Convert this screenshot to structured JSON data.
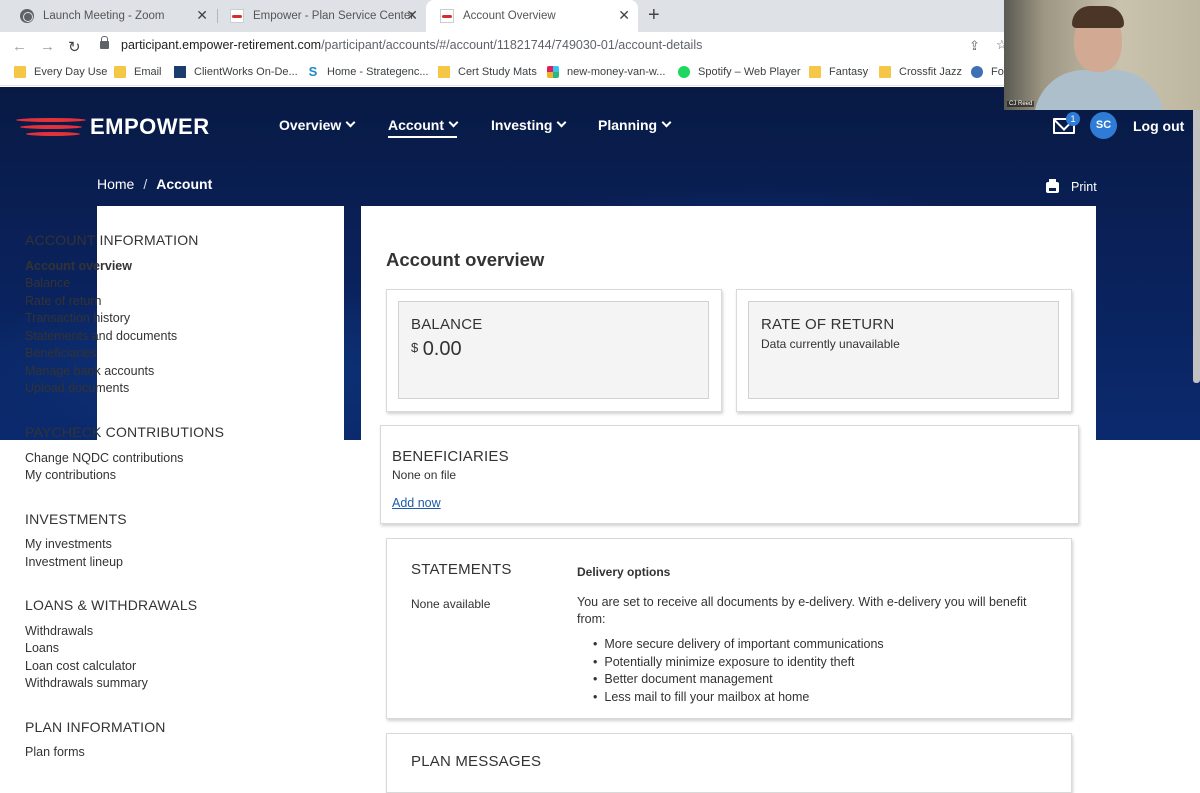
{
  "browser": {
    "tabs": [
      {
        "label": "Launch Meeting - Zoom"
      },
      {
        "label": "Empower - Plan Service Center"
      },
      {
        "label": "Account Overview"
      }
    ],
    "url": {
      "host": "participant.empower-retirement.com",
      "path": "/participant/accounts/#/account/11821744/749030-01/account-details"
    },
    "bookmarks": [
      {
        "label": "Every Day Use"
      },
      {
        "label": "Email"
      },
      {
        "label": "ClientWorks On-De..."
      },
      {
        "label": "Home - Strategenc..."
      },
      {
        "label": "Cert Study Mats"
      },
      {
        "label": "new-money-van-w..."
      },
      {
        "label": "Spotify – Web Player"
      },
      {
        "label": "Fantasy"
      },
      {
        "label": "Crossfit Jazz"
      },
      {
        "label": "Fo"
      }
    ]
  },
  "video": {
    "participant_name": "CJ Reed"
  },
  "site": {
    "brand": "EMPOWER",
    "nav": [
      {
        "label": "Overview"
      },
      {
        "label": "Account"
      },
      {
        "label": "Investing"
      },
      {
        "label": "Planning"
      }
    ],
    "mail_count": "1",
    "user_initials": "SC",
    "logout": "Log out",
    "breadcrumb": {
      "home": "Home",
      "separator": "/",
      "current": "Account"
    },
    "print": "Print"
  },
  "sidebar": {
    "sections": [
      {
        "heading": "ACCOUNT INFORMATION",
        "items": [
          "Account overview",
          "Balance",
          "Rate of return",
          "Transaction history",
          "Statements and documents",
          "Beneficiaries",
          "Manage bank accounts",
          "Upload documents"
        ]
      },
      {
        "heading": "PAYCHECK CONTRIBUTIONS",
        "items": [
          "Change NQDC contributions",
          "My contributions"
        ]
      },
      {
        "heading": "INVESTMENTS",
        "items": [
          "My investments",
          "Investment lineup"
        ]
      },
      {
        "heading": "LOANS & WITHDRAWALS",
        "items": [
          "Withdrawals",
          "Loans",
          "Loan cost calculator",
          "Withdrawals summary"
        ]
      },
      {
        "heading": "PLAN INFORMATION",
        "items": [
          "Plan forms"
        ]
      }
    ]
  },
  "main": {
    "title": "Account overview",
    "balance": {
      "title": "BALANCE",
      "currency": "$",
      "amount": "0.00"
    },
    "rate_of_return": {
      "title": "RATE OF RETURN",
      "status": "Data currently unavailable"
    },
    "beneficiaries": {
      "title": "BENEFICIARIES",
      "status": "None on file",
      "link": "Add now"
    },
    "statements": {
      "title": "STATEMENTS",
      "status": "None available",
      "delivery_title": "Delivery options",
      "delivery_text": "You are set to receive all documents by e-delivery. With e-delivery you will benefit from:",
      "benefits": [
        "More secure delivery of important communications",
        "Potentially minimize exposure to identity theft",
        "Better document management",
        "Less mail to fill your mailbox at home"
      ]
    },
    "plan_messages": {
      "title": "PLAN MESSAGES"
    }
  },
  "colors": {
    "hero_navy": "#0a2058",
    "brand_red": "#e4323d",
    "accent_blue": "#2e7cd6",
    "link_blue": "#1f5ba8"
  }
}
